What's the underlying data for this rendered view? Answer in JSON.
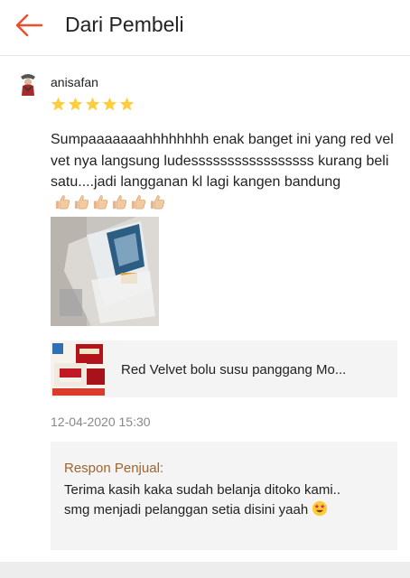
{
  "header": {
    "title": "Dari Pembeli",
    "back_icon": "arrow-left-icon",
    "accent_color": "#ee4d2d"
  },
  "review": {
    "username": "anisafan",
    "rating": 5,
    "rating_max": 5,
    "star_color": "#ffce3d",
    "text": "Sumpaaaaaaahhhhhhhh enak banget ini yang red velvet nya langsung ludesssssssssssssssss kurang beli satu....jadi langganan kl lagi kangen bandung",
    "thumbs_emoji_count": 6,
    "date": "12-04-2020 15:30"
  },
  "product": {
    "name": "Red Velvet bolu susu panggang Mo..."
  },
  "seller_response": {
    "label": "Respon Penjual:",
    "text": "Terima kasih kaka sudah belanja ditoko kami.. smg menjadi pelanggan setia disini yaah",
    "emoji": "star-struck-emoji"
  }
}
